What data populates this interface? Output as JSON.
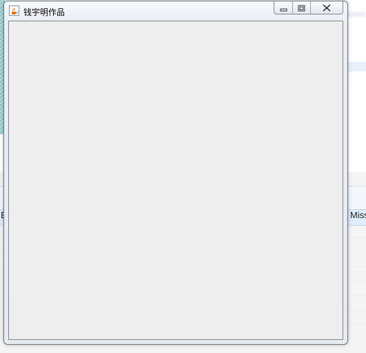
{
  "window": {
    "title": "钱宇明作品",
    "icon": "java-cup-icon",
    "controls": [
      "minimize-icon",
      "maximize-icon",
      "close-icon"
    ]
  },
  "background": {
    "table_column_left": "E",
    "table_column_right": "Miss"
  },
  "colors": {
    "content_background": "#eeeeee",
    "window_frame": "#e7ebf1"
  }
}
